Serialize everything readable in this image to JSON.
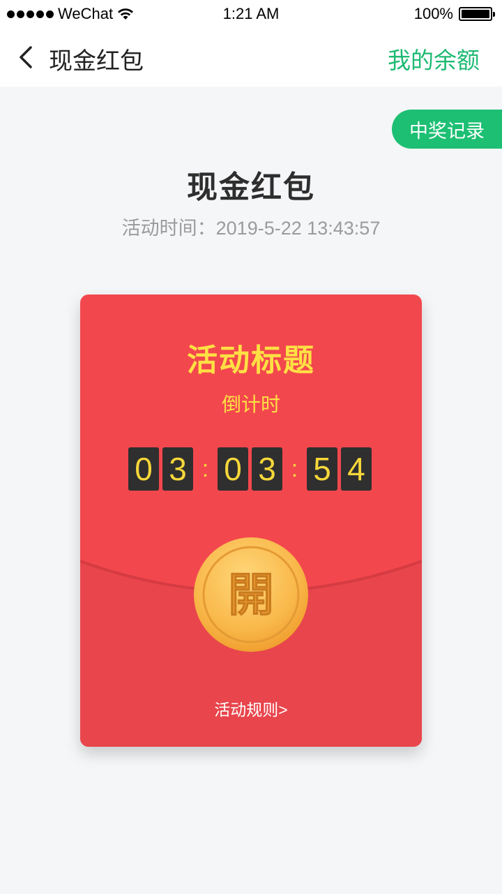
{
  "status_bar": {
    "carrier": "WeChat",
    "time": "1:21 AM",
    "battery": "100%",
    "battery_level": 1.0,
    "icons": [
      "signal-dots-icon",
      "wifi-icon",
      "battery-icon"
    ]
  },
  "nav": {
    "back_icon": "chevron-left-icon",
    "title": "现金红包",
    "balance_link": "我的余额"
  },
  "record_tab": "中奖记录",
  "page": {
    "title": "现金红包",
    "activity_time": "活动时间：2019-5-22 13:43:57"
  },
  "red_packet": {
    "title": "活动标题",
    "countdown_label": "倒计时",
    "countdown": {
      "h1": "0",
      "h2": "3",
      "sep1": ":",
      "m1": "0",
      "m2": "3",
      "sep2": ":",
      "s1": "5",
      "s2": "4"
    },
    "open_label": "開",
    "rules_link": "活动规则>"
  },
  "colors": {
    "accent_green": "#1dba73",
    "packet_red": "#f3474e",
    "packet_yellow": "#ffe044",
    "coin_gold": "#f7b23a"
  }
}
